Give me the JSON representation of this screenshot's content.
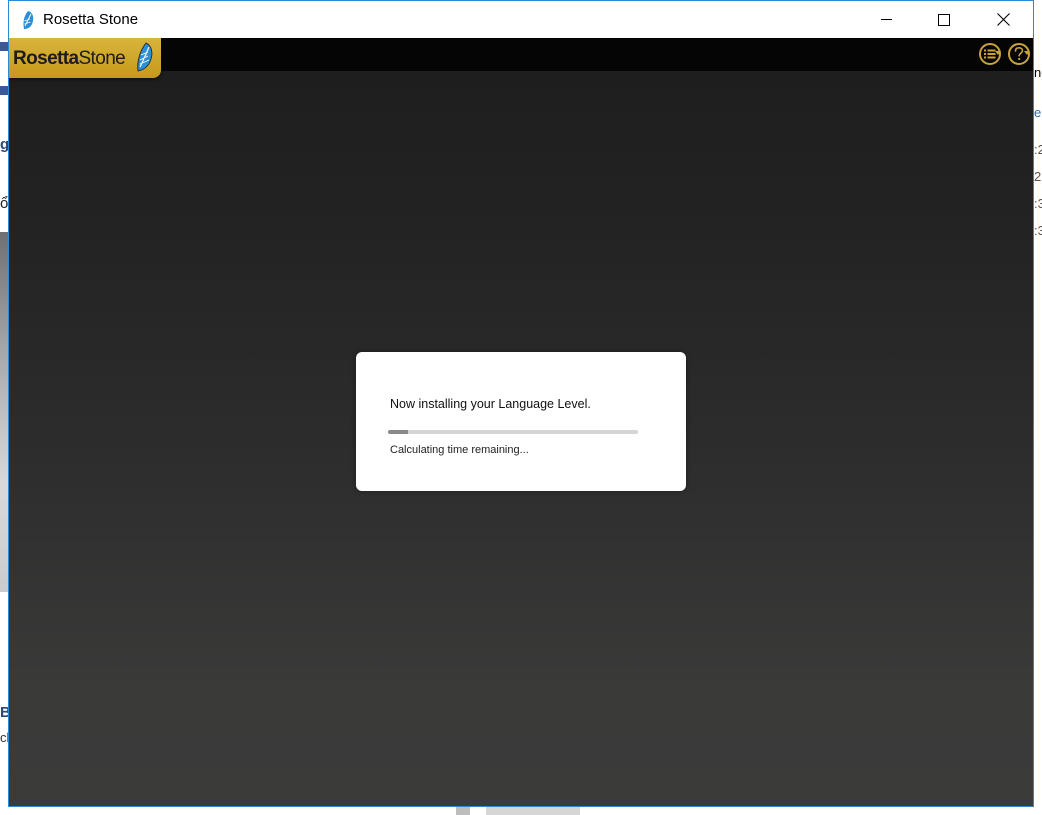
{
  "window": {
    "title": "Rosetta Stone"
  },
  "app": {
    "logo_text_bold": "Rosetta",
    "logo_text_light": "Stone",
    "menu_icon": "list-menu-icon",
    "help_icon": "help-icon",
    "accent_color": "#c9a23a"
  },
  "dialog": {
    "message": "Now installing your Language Level.",
    "status": "Calculating time remaining...",
    "progress_fraction": 0.08
  },
  "background": {
    "left_fragments": [
      "g",
      "ổ",
      "B",
      "cl"
    ],
    "right_fragments": [
      "ne",
      "e",
      ":2",
      "2",
      ":3",
      ":3"
    ]
  }
}
